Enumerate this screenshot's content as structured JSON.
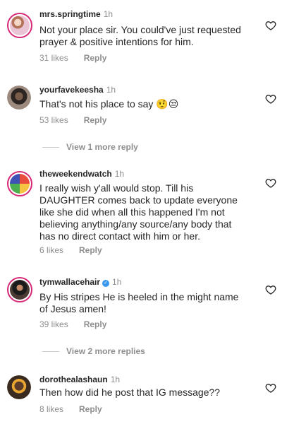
{
  "comments": [
    {
      "username": "mrs.springtime",
      "time": "1h",
      "text_lines": [
        "Not your place sir. You could've just requested",
        "prayer & positive intentions for him."
      ],
      "likes": "31 likes",
      "reply": "Reply",
      "verified": false
    },
    {
      "username": "yourfavekeesha",
      "time": "1h",
      "text_lines": [
        "That's not his place to say 🤨😒"
      ],
      "likes": "53 likes",
      "reply": "Reply",
      "verified": false
    },
    {
      "username": "theweekendwatch",
      "time": "1h",
      "text_lines": [
        "I really wish y'all would stop. Till his",
        "DAUGHTER comes back to update everyone",
        "like she did when all this happened I'm not",
        "believing anything/any source/any body that",
        "has no direct contact with him or her."
      ],
      "likes": "6 likes",
      "reply": "Reply",
      "verified": false
    },
    {
      "username": "tymwallacehair",
      "time": "1h",
      "text_lines": [
        "By His stripes He is heeled in the might name",
        "of Jesus amen!"
      ],
      "likes": "39 likes",
      "reply": "Reply",
      "verified": true
    },
    {
      "username": "dorothealashaun",
      "time": "1h",
      "text_lines": [
        "Then how did he post that IG message??"
      ],
      "likes": "8 likes",
      "reply": "Reply",
      "verified": false
    }
  ],
  "view_more": [
    {
      "label": "View 1 more reply"
    },
    {
      "label": "View 2 more replies"
    }
  ],
  "colors": {
    "text": "#262626",
    "secondary": "#8e8e8e",
    "story_ring": "#d62976",
    "verified": "#3897f0"
  },
  "icons": {
    "like": "heart-outline-icon",
    "verified": "verified-badge-icon"
  }
}
